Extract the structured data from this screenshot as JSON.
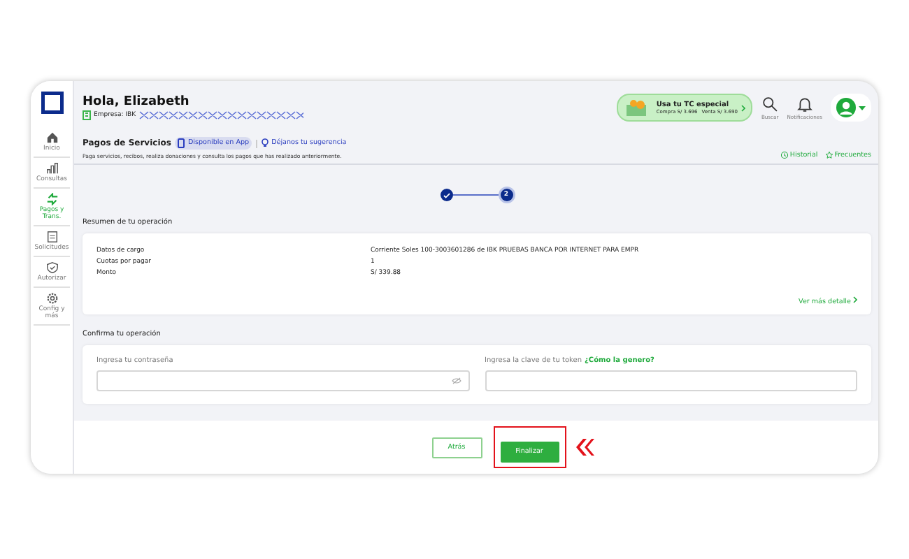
{
  "sidebar": {
    "items": [
      {
        "label": "Inicio",
        "selected": false
      },
      {
        "label": "Consultas",
        "selected": false
      },
      {
        "label": "Pagos y Trans.",
        "selected": true
      },
      {
        "label": "Solicitudes",
        "selected": false
      },
      {
        "label": "Autorizar",
        "selected": false
      },
      {
        "label": "Config y más",
        "selected": false
      }
    ]
  },
  "header": {
    "greeting": "Hola, Elizabeth",
    "company": "Empresa: IBK",
    "promo": {
      "title": "Usa tu TC especial",
      "buy": "Compra S/ 3.696",
      "sell": "Venta S/ 3.690"
    },
    "actions": [
      {
        "label": "Buscar"
      },
      {
        "label": "Notificaciones"
      }
    ]
  },
  "page": {
    "title": "Pagos de Servicios",
    "app_link": "Disponible en App",
    "suggest_link": "Déjanos tu sugerencia",
    "subtitle": "Paga servicios, recibos, realiza donaciones y consulta los pagos que has realizado anteriormente.",
    "links": [
      {
        "label": "Historial"
      },
      {
        "label": "Frecuentes"
      }
    ]
  },
  "stepper": [
    {
      "done": true
    },
    {
      "done": false,
      "number": "2"
    }
  ],
  "summary": {
    "heading": "Resumen de tu operación",
    "rows": [
      {
        "label": "Datos de cargo",
        "value": "Corriente Soles 100-3003601286 de IBK PRUEBAS BANCA POR INTERNET PARA EMPR"
      },
      {
        "label": "Cuotas por pagar",
        "value": "1"
      },
      {
        "label": "Monto",
        "value": "S/ 339.88"
      }
    ],
    "more_link": "Ver más detalle"
  },
  "confirm": {
    "heading": "Confirma tu operación",
    "fields": [
      {
        "label": "Ingresa tu contraseña",
        "kind": "password"
      },
      {
        "label": "Ingresa la clave de tu token",
        "help_link": "¿Cómo la genero?",
        "kind": "text"
      }
    ]
  },
  "buttons": [
    {
      "label": "Atrás",
      "kind": "secondary",
      "highlighted": false
    },
    {
      "label": "Finalizar",
      "kind": "primary",
      "highlighted": true
    }
  ]
}
